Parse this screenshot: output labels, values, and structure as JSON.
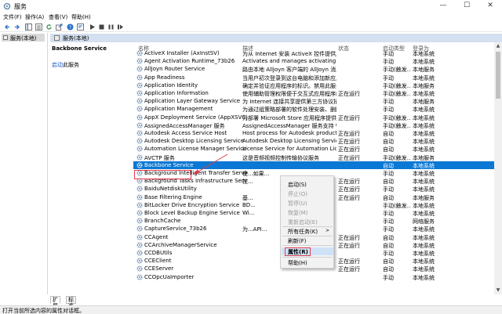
{
  "window": {
    "title": "服务",
    "minimize_icon": "minimize-icon",
    "maximize_icon": "maximize-icon",
    "close_icon": "close-icon"
  },
  "menu": [
    "文件(F)",
    "操作(A)",
    "查看(V)",
    "帮助(H)"
  ],
  "toolbar": [
    "back-arrow-icon",
    "forward-arrow-icon",
    "console-tree-icon",
    "list-view-icon",
    "refresh-icon",
    "export-icon",
    "help-icon",
    "properties-icon",
    "start-icon",
    "stop-icon",
    "pause-icon",
    "restart-icon"
  ],
  "tree": {
    "root": "服务(本地)"
  },
  "panel": {
    "header": "服务(本地)"
  },
  "description": {
    "title": "Backbone Service",
    "link": "启动",
    "link_suffix": "此服务"
  },
  "columns": {
    "name": "名称",
    "description": "描述",
    "status": "状态",
    "startup": "启动类型",
    "logon": "登录为"
  },
  "services": [
    {
      "name": "ActiveX Installer (AxInstSV)",
      "description": "为从 Internet 安装 ActiveX 控件提供用...",
      "status": "",
      "startup": "手动",
      "logon": "本地系统"
    },
    {
      "name": "Agent Activation Runtime_73b26",
      "description": "Activates and manages activating conversational ...",
      "status": "",
      "startup": "手动",
      "logon": "本地系统"
    },
    {
      "name": "AllJoyn Router Service",
      "description": "路由本地 AllJoyn 客户端的 AllJoyn 消息。如...",
      "status": "",
      "startup": "手动(触发...",
      "logon": "本地服务"
    },
    {
      "name": "App Readiness",
      "description": "当用户初次登录到这台电脑和添加新应用...",
      "status": "",
      "startup": "手动",
      "logon": "本地系统"
    },
    {
      "name": "Application Identity",
      "description": "确定并验证应用程序的标识。禁用此服务...",
      "status": "",
      "startup": "手动(触发...",
      "logon": "本地服务"
    },
    {
      "name": "Application Information",
      "description": "使用辅助管理权限便于交互式应用程序的...",
      "status": "正在运行",
      "startup": "手动(触发...",
      "logon": "本地系统"
    },
    {
      "name": "Application Layer Gateway Service",
      "description": "为 Internet 连接共享提供第三方协议插件...",
      "status": "",
      "startup": "手动",
      "logon": "本地服务"
    },
    {
      "name": "Application Management",
      "description": "为通过组策略部署的软件处理安装、删除...",
      "status": "",
      "startup": "手动",
      "logon": "本地系统"
    },
    {
      "name": "AppX Deployment Service (AppXSVC)",
      "description": "为部署 Microsoft Store 应用程序提供基...",
      "status": "正在运行",
      "startup": "手动(触发...",
      "logon": "本地系统"
    },
    {
      "name": "AssignedAccessManager 服务",
      "description": "AssignedAccessManager 服务支持 Wind...",
      "status": "",
      "startup": "手动(触发...",
      "logon": "本地系统"
    },
    {
      "name": "Autodesk Access Service Host",
      "description": "Host process for Autodesk product a...",
      "status": "正在运行",
      "startup": "自动",
      "logon": "本地系统"
    },
    {
      "name": "Autodesk Desktop Licensing Service",
      "description": "Autodesk Desktop Licensing Service...",
      "status": "正在运行",
      "startup": "自动",
      "logon": "本地系统"
    },
    {
      "name": "Automation License Manager Service",
      "description": "License Service for Automation Lice...",
      "status": "正在运行",
      "startup": "自动",
      "logon": "本地系统"
    },
    {
      "name": "AVCTP 服务",
      "description": "这是音频视频控制传输协议服务",
      "status": "正在运行",
      "startup": "手动(触发...",
      "logon": "本地服务"
    },
    {
      "name": "Backbone Service",
      "description": "",
      "status": "",
      "startup": "自动",
      "logon": "本地系统"
    },
    {
      "name": "Background Intelligent Transfer Service",
      "description": "使...如果...",
      "status": "",
      "startup": "手动",
      "logon": "本地系统"
    },
    {
      "name": "Background Tasks Infrastructure Service",
      "description": "控...",
      "status": "正在运行",
      "startup": "自动",
      "logon": "本地系统"
    },
    {
      "name": "BaiduNetdiskUtility",
      "description": "",
      "status": "正在运行",
      "startup": "手动",
      "logon": "本地系统"
    },
    {
      "name": "Base Filtering Engine",
      "description": "基...",
      "status": "正在运行",
      "startup": "自动",
      "logon": "本地服务"
    },
    {
      "name": "BitLocker Drive Encryption Service",
      "description": "BD...",
      "status": "",
      "startup": "手动(触发...",
      "logon": "本地系统"
    },
    {
      "name": "Block Level Backup Engine Service",
      "description": "Wi...",
      "status": "",
      "startup": "手动",
      "logon": "本地系统"
    },
    {
      "name": "BranchCache",
      "description": "",
      "status": "",
      "startup": "手动",
      "logon": "网络服务"
    },
    {
      "name": "CaptureService_73b26",
      "description": "为...API...",
      "status": "",
      "startup": "手动",
      "logon": "本地系统"
    },
    {
      "name": "CCAgent",
      "description": "",
      "status": "正在运行",
      "startup": "自动",
      "logon": "本地系统"
    },
    {
      "name": "CCArchiveManagerService",
      "description": "",
      "status": "正在运行",
      "startup": "自动",
      "logon": "本地系统"
    },
    {
      "name": "CCDBUtils",
      "description": "",
      "status": "",
      "startup": "手动",
      "logon": "本地系统"
    },
    {
      "name": "CCEClient",
      "description": "",
      "status": "正在运行",
      "startup": "自动",
      "logon": "本地系统"
    },
    {
      "name": "CCEServer",
      "description": "",
      "status": "正在运行",
      "startup": "自动",
      "logon": "本地系统"
    },
    {
      "name": "CCOpcUaImporter",
      "description": "",
      "status": "",
      "startup": "手动",
      "logon": "本地系统"
    }
  ],
  "context_menu": {
    "items": [
      {
        "label": "启动(S)",
        "enabled": true
      },
      {
        "label": "停止(O)",
        "enabled": false
      },
      {
        "label": "暂停(U)",
        "enabled": false
      },
      {
        "label": "恢复(M)",
        "enabled": false
      },
      {
        "label": "重新启动(E)",
        "enabled": false
      },
      {
        "label": "所有任务(K)",
        "enabled": true,
        "submenu": true
      },
      {
        "label": "刷新(F)",
        "enabled": true
      },
      {
        "label": "属性(R)",
        "enabled": true,
        "highlighted": true
      },
      {
        "label": "帮助(H)",
        "enabled": true
      }
    ]
  },
  "tabs": [
    "扩展",
    "标准"
  ],
  "status_bar": "打开当前所选内容的属性对话框。",
  "colors": {
    "selection": "#0a78d4",
    "annotation": "#e23b4c",
    "link": "#1a56c6",
    "gear": "#6f8db0"
  }
}
